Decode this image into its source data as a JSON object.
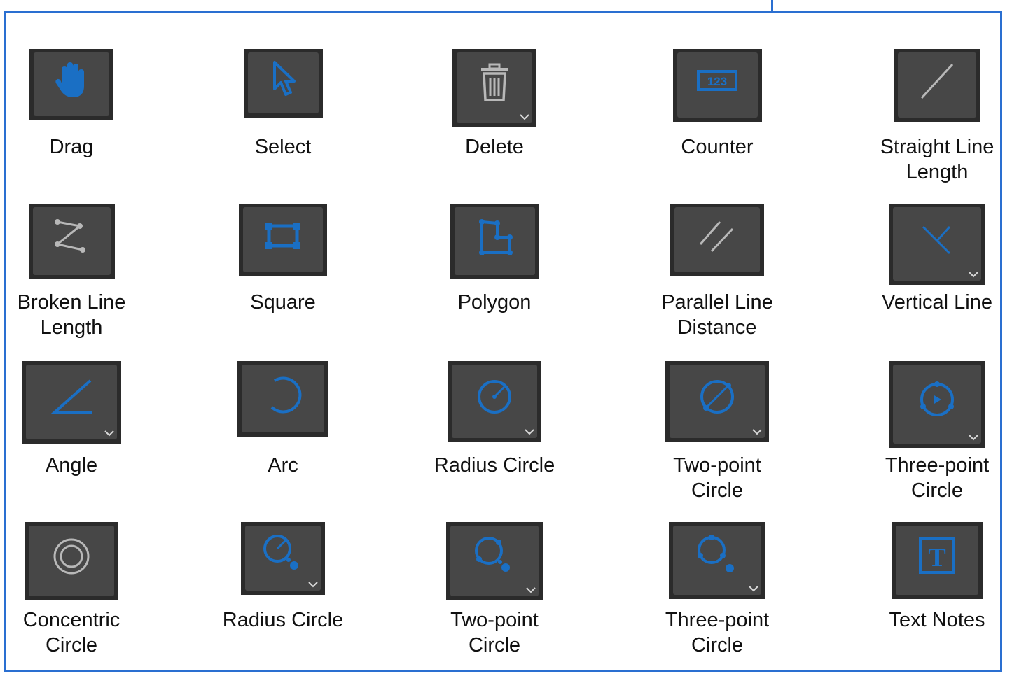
{
  "colors": {
    "frame": "#2a6fd1",
    "icon_blue": "#1a6fc4",
    "icon_gray": "#b8b8b8",
    "button_bg": "#474747",
    "button_border": "#2b2b2b"
  },
  "tools": [
    {
      "label": "Drag",
      "icon": "hand-icon",
      "dropdown": false
    },
    {
      "label": "Select",
      "icon": "cursor-arrow-icon",
      "dropdown": false
    },
    {
      "label": "Delete",
      "icon": "trash-icon",
      "dropdown": true
    },
    {
      "label": "Counter",
      "icon": "counter-icon",
      "dropdown": false
    },
    {
      "label": "Straight Line\nLength",
      "icon": "straight-line-icon",
      "dropdown": false
    },
    {
      "label": "Broken Line\nLength",
      "icon": "broken-line-icon",
      "dropdown": false
    },
    {
      "label": "Square",
      "icon": "square-icon",
      "dropdown": false
    },
    {
      "label": "Polygon",
      "icon": "polygon-icon",
      "dropdown": false
    },
    {
      "label": "Parallel Line\nDistance",
      "icon": "parallel-lines-icon",
      "dropdown": false
    },
    {
      "label": "Vertical Line",
      "icon": "vertical-line-icon",
      "dropdown": true
    },
    {
      "label": "Angle",
      "icon": "angle-icon",
      "dropdown": true
    },
    {
      "label": "Arc",
      "icon": "arc-icon",
      "dropdown": false
    },
    {
      "label": "Radius Circle",
      "icon": "radius-circle-icon",
      "dropdown": true
    },
    {
      "label": "Two-point\nCircle",
      "icon": "two-point-circle-icon",
      "dropdown": true
    },
    {
      "label": "Three-point\nCircle",
      "icon": "three-point-circle-icon",
      "dropdown": true
    },
    {
      "label": "Concentric\nCircle",
      "icon": "concentric-circle-icon",
      "dropdown": false
    },
    {
      "label": "Radius Circle",
      "icon": "radius-circle-distance-icon",
      "dropdown": true
    },
    {
      "label": "Two-point\nCircle",
      "icon": "two-point-circle-distance-icon",
      "dropdown": true
    },
    {
      "label": "Three-point\nCircle",
      "icon": "three-point-circle-distance-icon",
      "dropdown": true
    },
    {
      "label": "Text Notes",
      "icon": "text-notes-icon",
      "dropdown": false
    }
  ]
}
